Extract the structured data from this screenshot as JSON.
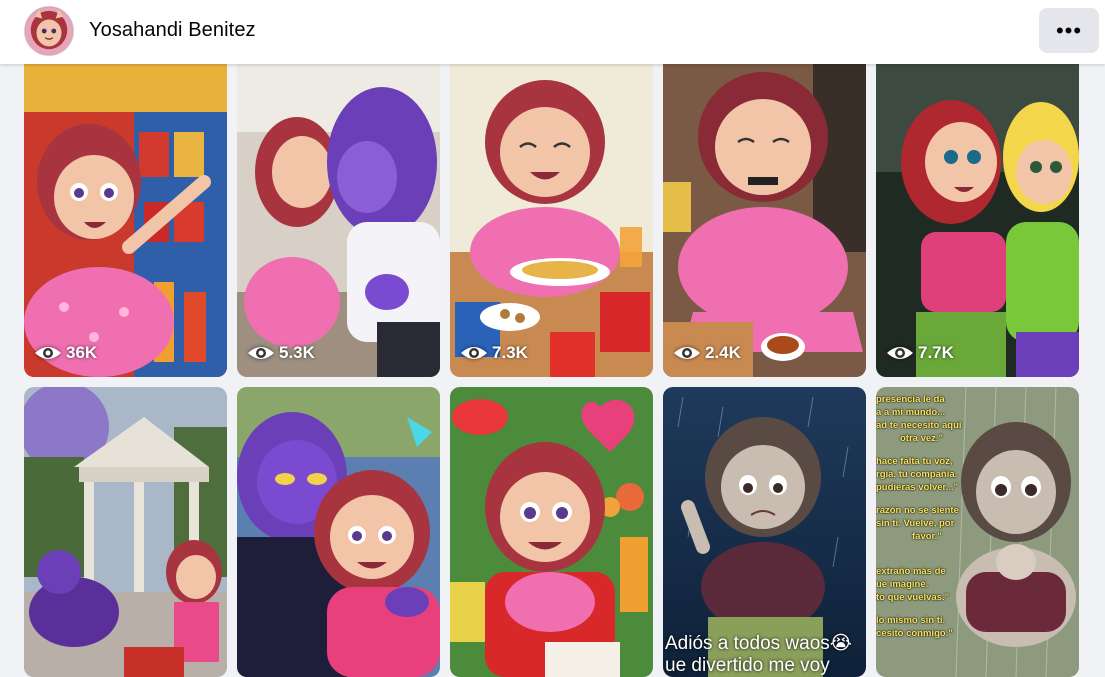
{
  "profile": {
    "name": "Yosahandi Benitez",
    "avatar_icon": "profile-avatar-icon"
  },
  "header": {
    "more_label": "•••"
  },
  "reels_row1": [
    {
      "views": "36K",
      "scene": "snack-aisle",
      "bg": "#c93a2c"
    },
    {
      "views": "5.3K",
      "scene": "kiss",
      "bg": "#d8d0c6"
    },
    {
      "views": "7.3K",
      "scene": "snack-table",
      "bg": "#f0ead9"
    },
    {
      "views": "2.4K",
      "scene": "street-food",
      "bg": "#7a5a44"
    },
    {
      "views": "7.7K",
      "scene": "two-friends",
      "bg": "#1e2a22"
    }
  ],
  "reels_row2": [
    {
      "scene": "gazebo",
      "bg": "#a9b7c8"
    },
    {
      "scene": "hug",
      "bg": "#5b7fb0"
    },
    {
      "scene": "drawing",
      "bg": "#4c8a3c"
    },
    {
      "scene": "rain",
      "caption": [
        "Adiós a todos waos😭",
        "ue divertido me voy"
      ],
      "bg": "#1f3a5c"
    },
    {
      "scene": "sad-text",
      "overlay": [
        "presencia le da",
        "a a mi mundo...",
        "ad te necesito aquí",
        "otra vez.\"",
        "",
        "hace falta tu voz,",
        "rgía, tu compañía.",
        "pudieras volver...\"",
        "",
        "razón no se siente",
        "sin ti. Vuelve, por",
        "favor.\"",
        "",
        "extraño más de",
        "ue imaginé.",
        "to que vuelvas.\"",
        "",
        "lo mismo sin ti.",
        "cesito conmigo.\""
      ],
      "bg": "#8d9a7e"
    }
  ],
  "icons": {
    "eye": "eye-icon",
    "more": "more-horizontal-icon"
  }
}
